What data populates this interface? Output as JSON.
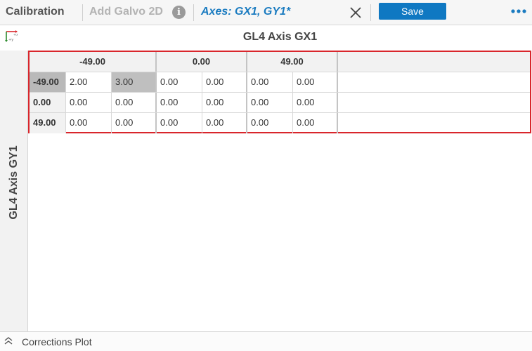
{
  "topbar": {
    "title": "Calibration",
    "subtitle": "Add Galvo 2D",
    "info_glyph": "i",
    "axes_label": "Axes: GX1, GY1*",
    "save_label": "Save"
  },
  "axis_x_title": "GL4 Axis GX1",
  "axis_y_title": "GL4 Axis GY1",
  "grid": {
    "column_headers": [
      "-49.00",
      "0.00",
      "49.00"
    ],
    "rows": [
      {
        "label": "-49.00",
        "values": [
          "2.00",
          "3.00",
          "0.00",
          "0.00",
          "0.00",
          "0.00"
        ]
      },
      {
        "label": "0.00",
        "values": [
          "0.00",
          "0.00",
          "0.00",
          "0.00",
          "0.00",
          "0.00"
        ]
      },
      {
        "label": "49.00",
        "values": [
          "0.00",
          "0.00",
          "0.00",
          "0.00",
          "0.00",
          "0.00"
        ]
      }
    ]
  },
  "bottombar": {
    "label": "Corrections Plot"
  },
  "colors": {
    "accent": "#1a7bc0",
    "save_button": "#0f78c2",
    "selection_border": "#d9262c"
  },
  "icons": {
    "info": "info-icon",
    "close": "close-icon",
    "more": "more-options-icon",
    "axis_orientation": "axis-orientation-icon",
    "expand": "expand-icon"
  }
}
